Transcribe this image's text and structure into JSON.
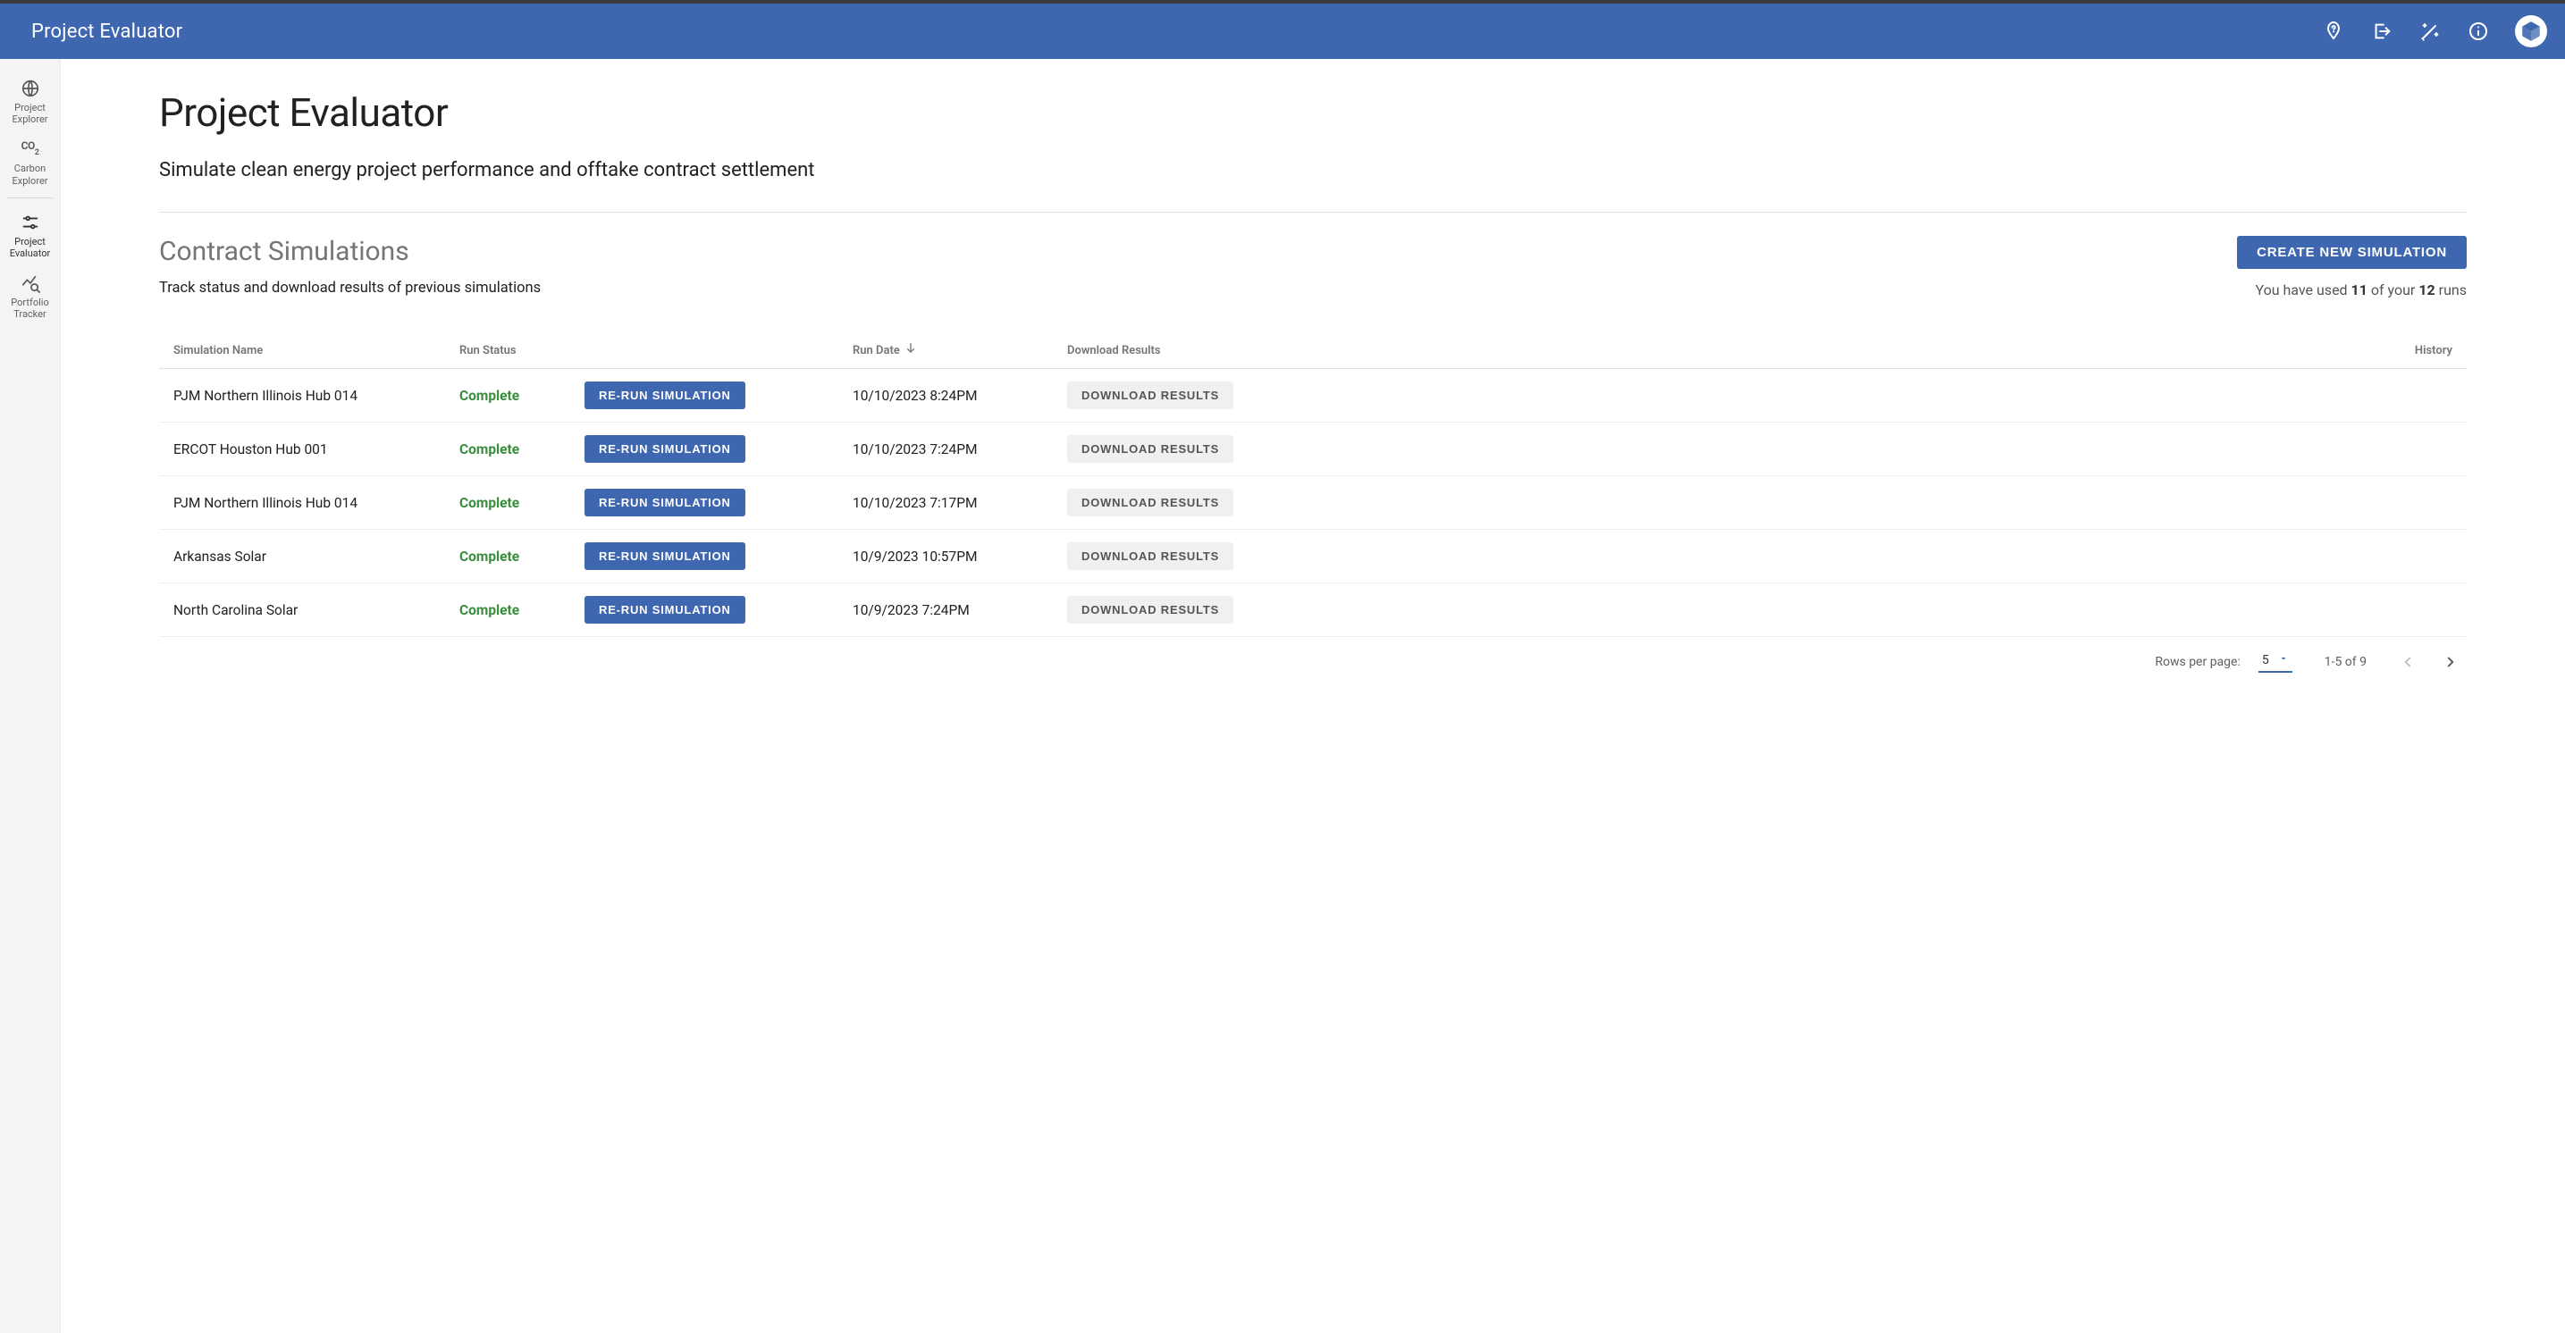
{
  "header": {
    "title": "Project Evaluator"
  },
  "sidebar": {
    "items": [
      {
        "label": "Project Explorer"
      },
      {
        "label": "Carbon Explorer"
      },
      {
        "label": "Project Evaluator"
      },
      {
        "label": "Portfolio Tracker"
      }
    ]
  },
  "page": {
    "title": "Project Evaluator",
    "subtitle": "Simulate clean energy project performance and offtake contract settlement"
  },
  "simulations": {
    "section_title": "Contract Simulations",
    "section_sub": "Track status and download results of previous simulations",
    "create_button": "CREATE NEW SIMULATION",
    "runs_info_prefix": "You have used ",
    "runs_used": "11",
    "runs_info_mid": " of your ",
    "runs_total": "12",
    "runs_info_suffix": " runs",
    "columns": {
      "name": "Simulation Name",
      "status": "Run Status",
      "blank": "",
      "date": "Run Date",
      "download": "Download Results",
      "history": "History"
    },
    "rerun_label": "RE-RUN SIMULATION",
    "download_label": "DOWNLOAD RESULTS",
    "rows": [
      {
        "name": "PJM Northern Illinois Hub 014",
        "status": "Complete",
        "date": "10/10/2023 8:24PM"
      },
      {
        "name": "ERCOT Houston Hub 001",
        "status": "Complete",
        "date": "10/10/2023 7:24PM"
      },
      {
        "name": "PJM Northern Illinois Hub 014",
        "status": "Complete",
        "date": "10/10/2023 7:17PM"
      },
      {
        "name": "Arkansas Solar",
        "status": "Complete",
        "date": "10/9/2023 10:57PM"
      },
      {
        "name": "North Carolina Solar",
        "status": "Complete",
        "date": "10/9/2023 7:24PM"
      }
    ]
  },
  "pagination": {
    "rows_per_page_label": "Rows per page:",
    "rows_per_page_value": "5",
    "range_text": "1-5 of 9"
  }
}
